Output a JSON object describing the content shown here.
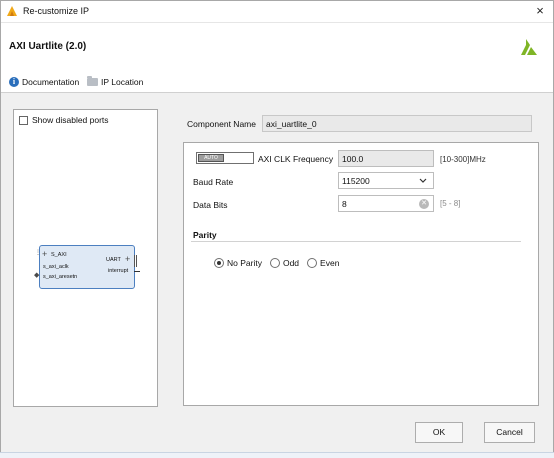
{
  "window": {
    "title": "Re-customize IP",
    "close_glyph": "×"
  },
  "header": {
    "ip_title": "AXI Uartlite (2.0)"
  },
  "links": {
    "documentation": "Documentation",
    "ip_location": "IP Location"
  },
  "left_panel": {
    "show_disabled_ports": "Show disabled ports",
    "show_disabled_checked": false,
    "symbol": {
      "s_axi": "S_AXI",
      "s_axi_aclk": "s_axi_aclk",
      "s_axi_aresetn": "s_axi_aresetn",
      "uart": "UART",
      "interrupt": "interrupt"
    }
  },
  "component": {
    "label": "Component Name",
    "value": "axi_uartlite_0"
  },
  "settings": {
    "auto_label": "AUTO",
    "clk_freq_label": "AXI CLK Frequency",
    "clk_freq_value": "100.0",
    "clk_freq_range": "[10-300]MHz",
    "baud_rate_label": "Baud Rate",
    "baud_rate_value": "115200",
    "data_bits_label": "Data Bits",
    "data_bits_value": "8",
    "data_bits_range": "[5 - 8]"
  },
  "parity": {
    "title": "Parity",
    "options": [
      "No Parity",
      "Odd",
      "Even"
    ],
    "selected": "No Parity"
  },
  "buttons": {
    "ok": "OK",
    "cancel": "Cancel"
  },
  "colors": {
    "accent": "#4c7fc0",
    "brand": "#7fb526"
  }
}
